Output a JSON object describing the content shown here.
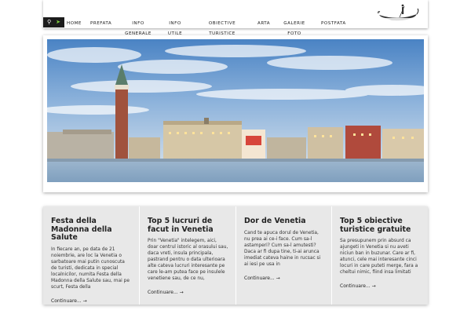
{
  "search": {
    "icon": "magnifier-icon",
    "go_icon": "go-arrow-icon"
  },
  "nav": {
    "items": [
      {
        "label": "HOME"
      },
      {
        "label": "PREFATA"
      },
      {
        "label": "INFO GENERALE"
      },
      {
        "label": "INFO UTILE"
      },
      {
        "label": "OBIECTIVE TURISTICE"
      },
      {
        "label": "ARTA"
      },
      {
        "label": "GALERIE FOTO"
      },
      {
        "label": "POSTFATA"
      }
    ]
  },
  "logo": {
    "icon": "gondola-logo"
  },
  "articles": [
    {
      "title": "Festa della Madonna della Salute",
      "text": "In fiecare an, pe data de 21 noiembrie, are loc la Venetia o sarbatoare mai putin cunoscuta de turisti, dedicata in special localnicilor, numita Festa della Madonna della Salute sau, mai pe scurt, Festa della",
      "more": "Continuare... →"
    },
    {
      "title": "Top 5 lucruri de facut in Venetia",
      "text": "Prin \"Venetia\" intelegem, aici, doar centrul istoric al orasului sau, daca vreti, insula principala, pastrand pentru o data ulterioara alte cateva lucruri interesante pe care le-am putea face pe insulele venetiene sau, de ce nu,",
      "more": "Continuare... →"
    },
    {
      "title": "Dor de Venetia",
      "text": "Cand te apuca dorul de Venetia, nu prea ai ce-i face. Cum sa-l astamperi? Cum sa-l amutesti? Daca ar fi dupa tine, ti-ai arunca imediat cateva haine in rucsac si ai iesi pe usa in",
      "more": "Continuare... →"
    },
    {
      "title": "Top 5 obiective turistice gratuite",
      "text": "Sa presupunem prin absurd ca ajungeti in Venetia si nu aveti niciun ban in buzunar. Care ar fi, atunci, cele mai interesante cinci locuri in care puteti merge, fara a cheltui nimic, fiind insa limitati",
      "more": "Continuare... →"
    }
  ]
}
